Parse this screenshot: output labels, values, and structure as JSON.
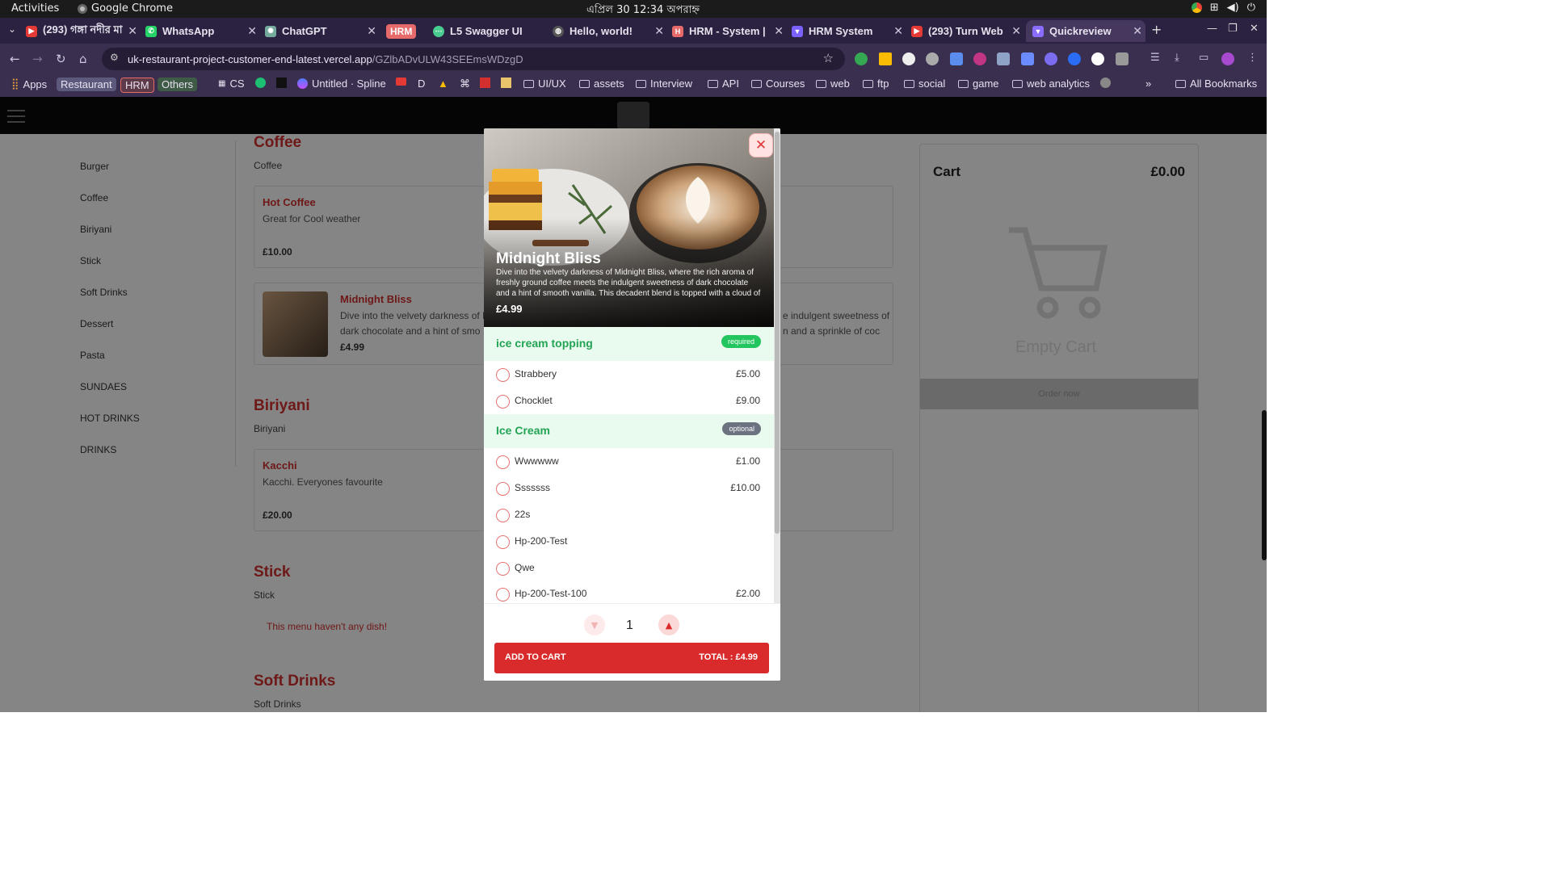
{
  "os": {
    "activities": "Activities",
    "app_name": "Google Chrome",
    "clock": "এপ্রিল 30  12:34 অপরাহ্ন"
  },
  "tabs": [
    {
      "title": "(293) গঙ্গা নদীর মা",
      "color": "#e53935"
    },
    {
      "title": "WhatsApp",
      "color": "#25d366"
    },
    {
      "title": "ChatGPT",
      "color": "#74aa9c"
    },
    {
      "title": "HRM",
      "color": "#e66a6a"
    },
    {
      "title": "L5 Swagger UI",
      "color": "#49cc90"
    },
    {
      "title": "Hello, world!",
      "color": "#bbbbbb"
    },
    {
      "title": "HRM - System |",
      "color": "#e66a6a"
    },
    {
      "title": "HRM System",
      "color": "#7b61ff"
    },
    {
      "title": "(293) Turn Web",
      "color": "#e53935"
    },
    {
      "title": "Quickreview",
      "color": "#8a6cff"
    }
  ],
  "address": {
    "domain": "uk-restaurant-project-customer-end-latest.vercel.app",
    "path": "/GZlbADvULW43SEEmsWDzgD"
  },
  "bookmarks": [
    "Apps",
    "Restaurant",
    "HRM",
    "Others",
    "CS",
    "Untitled · Spline",
    "D",
    "UI/UX",
    "assets",
    "Interview",
    "API",
    "Courses",
    "web",
    "ftp",
    "social",
    "game",
    "web analytics",
    "All Bookmarks"
  ],
  "categories": [
    "Burger",
    "Coffee",
    "Biriyani",
    "Stick",
    "Soft Drinks",
    "Dessert",
    "Pasta",
    "SUNDAES",
    "HOT DRINKS",
    "DRINKS"
  ],
  "menu": {
    "coffee_title": "Coffee",
    "coffee_sub": "Coffee",
    "hot_coffee": {
      "name": "Hot Coffee",
      "desc": "Great for Cool weather",
      "price": "£10.00"
    },
    "midnight": {
      "name": "Midnight Bliss",
      "desc_left": "Dive into the velvety darkness of M",
      "desc_right": "e indulgent sweetness of",
      "desc_left2": "dark chocolate and a hint of smo",
      "desc_right2": "n and a sprinkle of coc",
      "price": "£4.99"
    },
    "biriyani_title": "Biriyani",
    "biriyani_sub": "Biriyani",
    "kacchi": {
      "name": "Kacchi",
      "desc": "Kacchi. Everyones favourite",
      "price": "£20.00"
    },
    "stick_title": "Stick",
    "stick_sub": "Stick",
    "stick_empty": "This menu haven't any dish!",
    "soft_title": "Soft Drinks",
    "soft_sub": "Soft Drinks"
  },
  "cart": {
    "title": "Cart",
    "total": "£0.00",
    "empty": "Empty Cart",
    "order_btn": "Order now"
  },
  "modal": {
    "title": "Midnight Bliss",
    "description": "Dive into the velvety darkness of Midnight Bliss, where the rich aroma of freshly ground coffee meets the indulgent sweetness of dark chocolate and a hint of smooth vanilla. This decadent blend is topped with a cloud of whipped cream and a",
    "price": "£4.99",
    "groups": [
      {
        "title": "ice cream topping",
        "badge": "required",
        "badge_color": "#22c55e",
        "options": [
          {
            "name": "Strabbery",
            "price": "£5.00"
          },
          {
            "name": "Chocklet",
            "price": "£9.00"
          }
        ]
      },
      {
        "title": "Ice Cream",
        "badge": "optional",
        "badge_color": "#6b7280",
        "options": [
          {
            "name": "Wwwwww",
            "price": "£1.00"
          },
          {
            "name": "Sssssss",
            "price": "£10.00"
          },
          {
            "name": "22s",
            "price": ""
          },
          {
            "name": "Hp-200-Test",
            "price": ""
          },
          {
            "name": "Qwe",
            "price": ""
          },
          {
            "name": "Hp-200-Test-100",
            "price": "£2.00"
          }
        ]
      }
    ],
    "quantity": "1",
    "add_label": "ADD TO CART",
    "total_label": "TOTAL : £4.99"
  }
}
